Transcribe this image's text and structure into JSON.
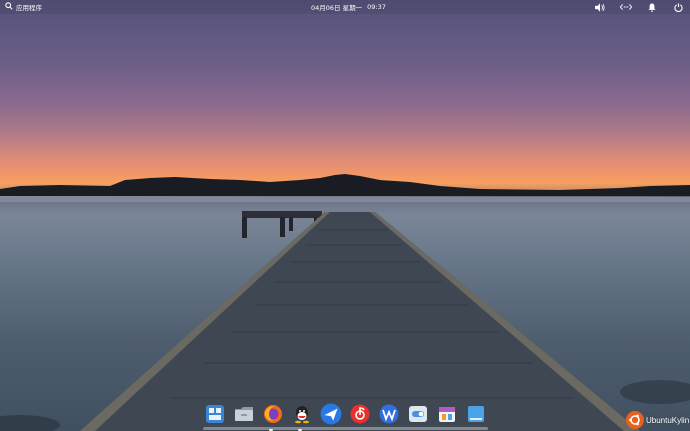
{
  "topbar": {
    "apps_label": "应用程序",
    "date": "04月06日 星期一",
    "time": "09:37",
    "icons": [
      "search-icon",
      "volume-icon",
      "network-icon",
      "notification-bell-icon",
      "power-icon"
    ]
  },
  "dock": {
    "items": [
      {
        "name": "multitasking-view-icon",
        "color": "#3a86d4"
      },
      {
        "name": "file-manager-icon",
        "color": "#b9c3cc"
      },
      {
        "name": "firefox-icon",
        "color": "#f06a1a"
      },
      {
        "name": "qq-icon",
        "color": "#ffffff"
      },
      {
        "name": "feishu-icon",
        "color": "#2a78e4"
      },
      {
        "name": "netease-music-icon",
        "color": "#e8302e"
      },
      {
        "name": "wps-office-icon",
        "color": "#2f6fe0"
      },
      {
        "name": "settings-toggle-icon",
        "color": "#dfe6ee"
      },
      {
        "name": "software-store-icon",
        "color": "#b05cc4"
      },
      {
        "name": "desktop-icon",
        "color": "#4aa3e8"
      }
    ]
  },
  "branding": {
    "logo_text": "UbuntuKylin",
    "logo_color": "#e8601c"
  },
  "colors": {
    "sky_top": "#54527a",
    "horizon": "#f6a060",
    "water": "#6c7b8d"
  }
}
